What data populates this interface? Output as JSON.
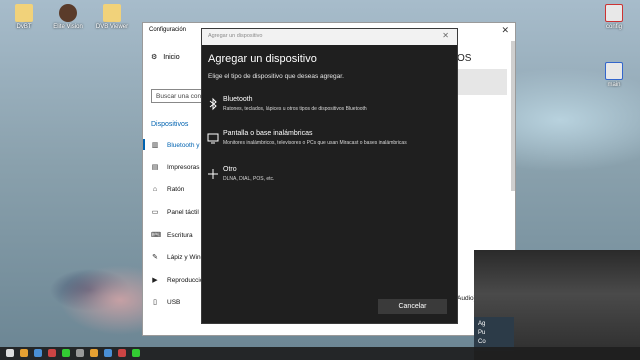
{
  "desktop": {
    "icons": [
      {
        "label": "DvBT"
      },
      {
        "label": "Elite Vision"
      },
      {
        "label": "DVB Viewer"
      },
      {
        "label": "config"
      },
      {
        "label": "main"
      }
    ]
  },
  "settings": {
    "title": "Configuración",
    "home": "Inicio",
    "search_placeholder": "Buscar una config",
    "section": "Dispositivos",
    "items": [
      {
        "label": "Bluetooth y",
        "icon": "bluetooth-icon"
      },
      {
        "label": "Impresoras y",
        "icon": "printer-icon"
      },
      {
        "label": "Ratón",
        "icon": "mouse-icon"
      },
      {
        "label": "Panel táctil",
        "icon": "touchpad-icon"
      },
      {
        "label": "Escritura",
        "icon": "keyboard-icon"
      },
      {
        "label": "Lápiz y Wind",
        "icon": "pen-icon"
      },
      {
        "label": "Reproducción",
        "icon": "autoplay-icon"
      },
      {
        "label": "USB",
        "icon": "usb-icon"
      }
    ],
    "right_heading": "OS",
    "right_text": "Audio)"
  },
  "dialog": {
    "titlebar": "Agregar un dispositivo",
    "heading": "Agregar un dispositivo",
    "subtitle": "Elige el tipo de dispositivo que deseas agregar.",
    "options": [
      {
        "title": "Bluetooth",
        "desc": "Ratones, teclados, lápices u otros tipos de dispositivos Bluetooth",
        "icon": "bluetooth-icon"
      },
      {
        "title": "Pantalla o base inalámbricas",
        "desc": "Monitores inalámbricos, televisores o PCs que usan Miracast o bases inalámbricas",
        "icon": "monitor-icon"
      },
      {
        "title": "Otro",
        "desc": "DLNA, DIAL, POS, etc.",
        "icon": "plus-icon"
      }
    ],
    "cancel_label": "Cancelar"
  },
  "notification": {
    "line1": "Ag",
    "line2": "Pu",
    "line3": "Co"
  }
}
